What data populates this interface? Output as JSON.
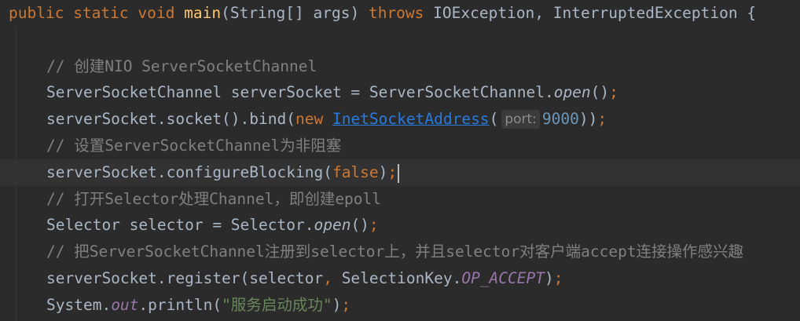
{
  "editor": {
    "line1": {
      "public": "public",
      "static": "static",
      "void": "void",
      "method": "main",
      "params": "(String[] args)",
      "throws": "throws",
      "exceptions": "IOException,",
      "exception2": "InterruptedException",
      "brace": "{"
    },
    "line3": {
      "comment": "// 创建NIO ServerSocketChannel"
    },
    "line4": {
      "decl": "ServerSocketChannel serverSocket = ServerSocketChannel.",
      "method": "open",
      "parens": "()",
      "semi": ";"
    },
    "line5": {
      "prefix": "serverSocket.socket().bind(",
      "new": "new",
      "class": "InetSocketAddress",
      "open_paren": "(",
      "hint": "port:",
      "value": "9000",
      "close": "))",
      "semi": ";"
    },
    "line6": {
      "comment": "// 设置ServerSocketChannel为非阻塞"
    },
    "line7": {
      "prefix": "serverSocket.configureBlocking(",
      "value": "false",
      "close": ")",
      "semi": ";"
    },
    "line8": {
      "comment": "// 打开Selector处理Channel，即创建epoll"
    },
    "line9": {
      "decl": "Selector selector = Selector.",
      "method": "open",
      "parens": "()",
      "semi": ";"
    },
    "line10": {
      "comment": "// 把ServerSocketChannel注册到selector上，并且selector对客户端accept连接操作感兴趣"
    },
    "line11": {
      "prefix": "serverSocket.register(selector",
      "comma": ",",
      "mid": " SelectionKey.",
      "constant": "OP_ACCEPT",
      "close": ")",
      "semi": ";"
    },
    "line12": {
      "prefix": "System.",
      "field": "out",
      "mid": ".println(",
      "string": "\"服务启动成功\"",
      "close": ")",
      "semi": ";"
    }
  }
}
